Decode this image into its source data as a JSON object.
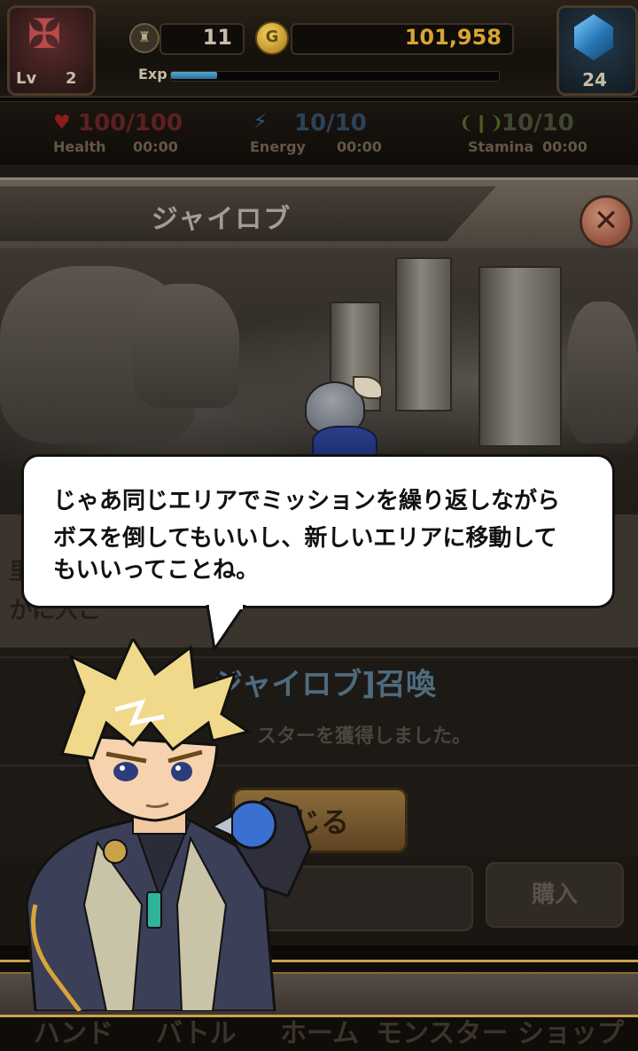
{
  "hud": {
    "level_label": "Lv",
    "level_value": "2",
    "rank_value": "11",
    "gold_value": "101,958",
    "exp_label": "Exp",
    "exp_progress": 0.14,
    "gem_value": "24"
  },
  "stats": {
    "health_value": "100/100",
    "health_label": "Health",
    "health_timer": "00:00",
    "energy_value": "10/10",
    "energy_label": "Energy",
    "energy_timer": "00:00",
    "stamina_value": "10/10",
    "stamina_label": "Stamina",
    "stamina_timer": "00:00"
  },
  "modal": {
    "title": "ジャイロブ",
    "result_title": "ジャイロブ]召喚",
    "result_subtitle": "スターを獲得しました。",
    "close_button_label": "じる",
    "buy_button_label": "購入"
  },
  "background_text": {
    "line_1": "里",
    "line_2": "かに入こ"
  },
  "dialog": {
    "line_1": "じゃあ同じエリアでミッションを繰り返しながら",
    "line_2": "ボスを倒してもいいし、新しいエリアに移動して",
    "line_3": "もいいってことね。"
  },
  "nav": {
    "items": [
      "ハンド",
      "バトル",
      "ホーム",
      "モンスター",
      "ショップ"
    ]
  },
  "colors": {
    "gold": "#d7a531",
    "exp": "#53a8d8",
    "bubble_bg": "#ffffff",
    "nav_gold": "#c9a24a"
  },
  "icons": {
    "avatar": "demon-avatar-icon",
    "rank": "rank-badge-icon",
    "coin": "gold-coin-icon",
    "gem": "blue-gem-icon",
    "health": "heart-icon",
    "energy": "energy-icon",
    "stamina": "stamina-icon",
    "close": "close-x-icon"
  }
}
